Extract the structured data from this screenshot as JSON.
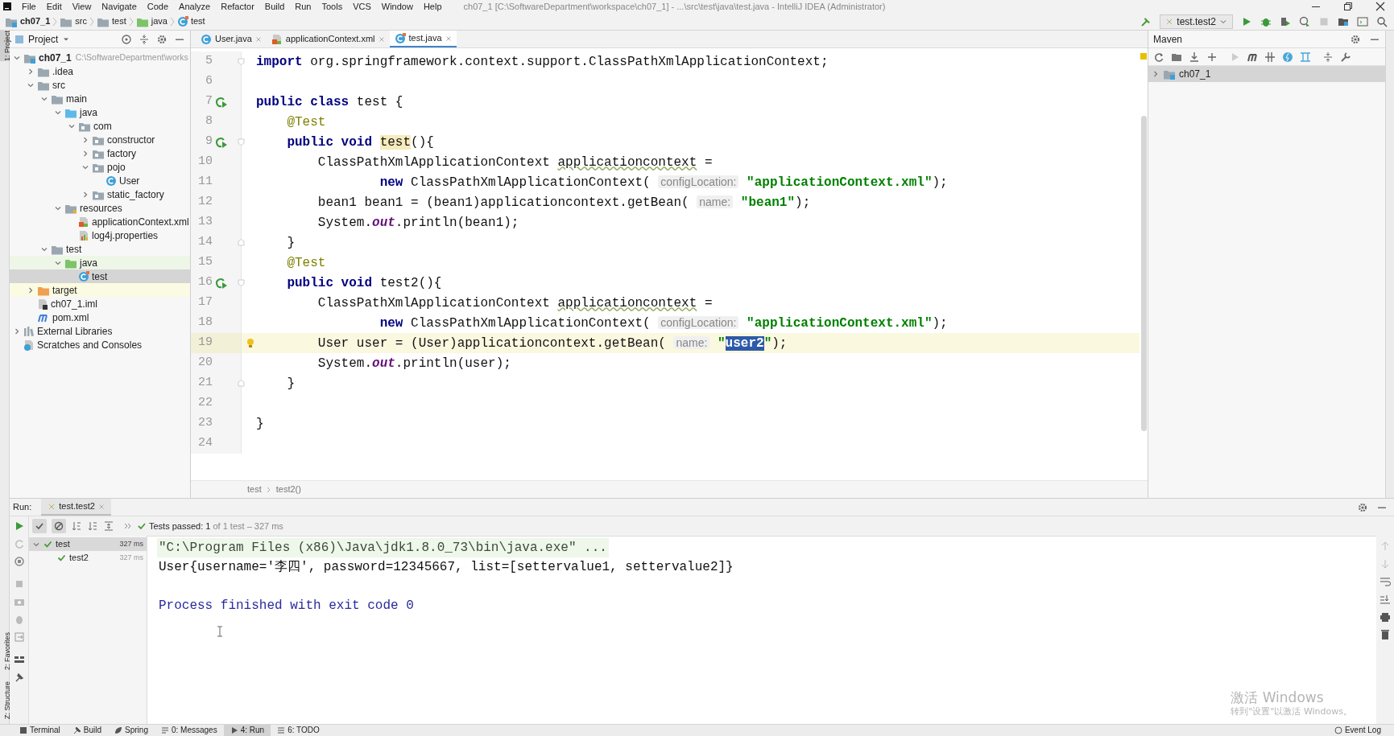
{
  "window": {
    "menu": [
      "File",
      "Edit",
      "View",
      "Navigate",
      "Code",
      "Analyze",
      "Refactor",
      "Build",
      "Run",
      "Tools",
      "VCS",
      "Window",
      "Help"
    ],
    "title": "ch07_1 [C:\\SoftwareDepartment\\workspace\\ch07_1] - ...\\src\\test\\java\\test.java - IntelliJ IDEA (Administrator)"
  },
  "side_tabs": [
    {
      "label": "1: Project",
      "selected": true
    },
    {
      "label": "2: Favorites",
      "selected": false
    },
    {
      "label": "Z: Structure",
      "selected": false
    }
  ],
  "navbar": {
    "breadcrumbs": [
      {
        "label": "ch07_1",
        "kind": "module"
      },
      {
        "label": "src",
        "kind": "folder"
      },
      {
        "label": "test",
        "kind": "folder"
      },
      {
        "label": "java",
        "kind": "test-source"
      },
      {
        "label": "test",
        "kind": "test-class"
      }
    ],
    "run_config": "test.test2"
  },
  "project_panel": {
    "title": "Project",
    "tree": [
      {
        "label": "ch07_1",
        "path": "C:\\SoftwareDepartment\\works",
        "kind": "module",
        "expanded": true,
        "selected": false,
        "children": [
          {
            "label": ".idea",
            "kind": "folder",
            "expanded": false,
            "selected": false
          },
          {
            "label": "src",
            "kind": "folder",
            "expanded": true,
            "selected": false,
            "children": [
              {
                "label": "main",
                "kind": "folder",
                "expanded": true,
                "selected": false,
                "children": [
                  {
                    "label": "java",
                    "kind": "source",
                    "expanded": true,
                    "selected": false,
                    "children": [
                      {
                        "label": "com",
                        "kind": "package",
                        "expanded": true,
                        "selected": false,
                        "children": [
                          {
                            "label": "constructor",
                            "kind": "package",
                            "expanded": false,
                            "selected": false
                          },
                          {
                            "label": "factory",
                            "kind": "package",
                            "expanded": false,
                            "selected": false
                          },
                          {
                            "label": "pojo",
                            "kind": "package",
                            "expanded": true,
                            "selected": false,
                            "children": [
                              {
                                "label": "User",
                                "kind": "class",
                                "selected": false
                              }
                            ]
                          },
                          {
                            "label": "static_factory",
                            "kind": "package",
                            "expanded": false,
                            "selected": false
                          }
                        ]
                      }
                    ]
                  },
                  {
                    "label": "resources",
                    "kind": "resources",
                    "expanded": true,
                    "selected": false,
                    "children": [
                      {
                        "label": "applicationContext.xml",
                        "kind": "xml",
                        "selected": false
                      },
                      {
                        "label": "log4j.properties",
                        "kind": "properties",
                        "selected": false
                      }
                    ]
                  }
                ]
              },
              {
                "label": "test",
                "kind": "folder",
                "expanded": true,
                "selected": false,
                "children": [
                  {
                    "label": "java",
                    "kind": "test-source",
                    "expanded": true,
                    "selected": false,
                    "children": [
                      {
                        "label": "test",
                        "kind": "test-class",
                        "selected": true
                      }
                    ]
                  }
                ]
              }
            ]
          },
          {
            "label": "target",
            "kind": "excluded",
            "expanded": false,
            "selected": false
          },
          {
            "label": "ch07_1.iml",
            "kind": "iml",
            "selected": false
          },
          {
            "label": "pom.xml",
            "kind": "maven",
            "selected": false
          }
        ]
      },
      {
        "label": "External Libraries",
        "kind": "libraries",
        "expanded": false,
        "selected": false
      },
      {
        "label": "Scratches and Consoles",
        "kind": "scratches",
        "selected": false
      }
    ]
  },
  "editor": {
    "tabs": [
      {
        "label": "User.java",
        "kind": "class",
        "selected": false
      },
      {
        "label": "applicationContext.xml",
        "kind": "xml",
        "selected": false
      },
      {
        "label": "test.java",
        "kind": "test-class",
        "selected": true
      }
    ],
    "lines": [
      {
        "number": "5",
        "current": false,
        "run_marker": false,
        "bulb": false,
        "fold_start": true,
        "fold_end": false,
        "tokens": [
          {
            "kind": "keyword",
            "text": "import "
          },
          {
            "kind": "plain",
            "text": "org.springframework.context.support.ClassPathXmlApplicationContext;"
          }
        ]
      },
      {
        "number": "6",
        "current": false,
        "run_marker": false,
        "bulb": false,
        "fold_start": false,
        "fold_end": false
      },
      {
        "number": "7",
        "current": false,
        "run_marker": true,
        "bulb": false,
        "fold_start": false,
        "fold_end": false,
        "tokens": [
          {
            "kind": "keyword",
            "text": "public class "
          },
          {
            "kind": "plain",
            "text": "test {"
          }
        ]
      },
      {
        "number": "8",
        "current": false,
        "run_marker": false,
        "bulb": false,
        "fold_start": false,
        "fold_end": false,
        "tokens": [
          {
            "kind": "annotation",
            "text": "    @Test"
          }
        ]
      },
      {
        "number": "9",
        "current": false,
        "run_marker": true,
        "bulb": false,
        "fold_start": true,
        "fold_end": false,
        "tokens": [
          {
            "kind": "keyword",
            "text": "    public void "
          },
          {
            "kind": "match",
            "text": "test"
          },
          {
            "kind": "plain",
            "text": "(){"
          }
        ]
      },
      {
        "number": "10",
        "current": false,
        "run_marker": false,
        "bulb": false,
        "fold_start": false,
        "fold_end": false,
        "tokens": [
          {
            "kind": "plain",
            "text": "        ClassPathXmlApplicationContext "
          },
          {
            "kind": "warning",
            "text": "applicationcontext"
          },
          {
            "kind": "plain",
            "text": " ="
          }
        ]
      },
      {
        "number": "11",
        "current": false,
        "run_marker": false,
        "bulb": false,
        "fold_start": false,
        "fold_end": false,
        "tokens": [
          {
            "kind": "keyword",
            "text": "                new "
          },
          {
            "kind": "plain",
            "text": "ClassPathXmlApplicationContext( "
          },
          {
            "kind": "hint",
            "text": "configLocation:"
          },
          {
            "kind": "string",
            "text": " \"applicationContext.xml\""
          },
          {
            "kind": "plain",
            "text": ");"
          }
        ]
      },
      {
        "number": "12",
        "current": false,
        "run_marker": false,
        "bulb": false,
        "fold_start": false,
        "fold_end": false,
        "tokens": [
          {
            "kind": "plain",
            "text": "        bean1 bean1 = (bean1)applicationcontext.getBean( "
          },
          {
            "kind": "hint",
            "text": "name:"
          },
          {
            "kind": "string",
            "text": " \"bean1\""
          },
          {
            "kind": "plain",
            "text": ");"
          }
        ]
      },
      {
        "number": "13",
        "current": false,
        "run_marker": false,
        "bulb": false,
        "fold_start": false,
        "fold_end": false,
        "tokens": [
          {
            "kind": "plain",
            "text": "        System."
          },
          {
            "kind": "static",
            "text": "out"
          },
          {
            "kind": "plain",
            "text": ".println(bean1);"
          }
        ]
      },
      {
        "number": "14",
        "current": false,
        "run_marker": false,
        "bulb": false,
        "fold_start": false,
        "fold_end": true,
        "tokens": [
          {
            "kind": "plain",
            "text": "    }"
          }
        ]
      },
      {
        "number": "15",
        "current": false,
        "run_marker": false,
        "bulb": false,
        "fold_start": false,
        "fold_end": false,
        "tokens": [
          {
            "kind": "annotation",
            "text": "    @Test"
          }
        ]
      },
      {
        "number": "16",
        "current": false,
        "run_marker": true,
        "bulb": false,
        "fold_start": true,
        "fold_end": false,
        "tokens": [
          {
            "kind": "keyword",
            "text": "    public void "
          },
          {
            "kind": "plain",
            "text": "test2(){"
          }
        ]
      },
      {
        "number": "17",
        "current": false,
        "run_marker": false,
        "bulb": false,
        "fold_start": false,
        "fold_end": false,
        "tokens": [
          {
            "kind": "plain",
            "text": "        ClassPathXmlApplicationContext "
          },
          {
            "kind": "warning",
            "text": "applicationcontext"
          },
          {
            "kind": "plain",
            "text": " ="
          }
        ]
      },
      {
        "number": "18",
        "current": false,
        "run_marker": false,
        "bulb": false,
        "fold_start": false,
        "fold_end": false,
        "tokens": [
          {
            "kind": "keyword",
            "text": "                new "
          },
          {
            "kind": "plain",
            "text": "ClassPathXmlApplicationContext( "
          },
          {
            "kind": "hint",
            "text": "configLocation:"
          },
          {
            "kind": "string",
            "text": " \"applicationContext.xml\""
          },
          {
            "kind": "plain",
            "text": ");"
          }
        ]
      },
      {
        "number": "19",
        "current": true,
        "run_marker": false,
        "bulb": true,
        "fold_start": false,
        "fold_end": false,
        "tokens": [
          {
            "kind": "plain",
            "text": "        User user = (User)applicationcontext.getBean( "
          },
          {
            "kind": "hint",
            "text": "name:"
          },
          {
            "kind": "string",
            "text": " \""
          },
          {
            "kind": "selection",
            "text": "user2"
          },
          {
            "kind": "string",
            "text": "\""
          },
          {
            "kind": "plain",
            "text": ");"
          }
        ]
      },
      {
        "number": "20",
        "current": false,
        "run_marker": false,
        "bulb": false,
        "fold_start": false,
        "fold_end": false,
        "tokens": [
          {
            "kind": "plain",
            "text": "        System."
          },
          {
            "kind": "static",
            "text": "out"
          },
          {
            "kind": "plain",
            "text": ".println(user);"
          }
        ]
      },
      {
        "number": "21",
        "current": false,
        "run_marker": false,
        "bulb": false,
        "fold_start": false,
        "fold_end": true,
        "tokens": [
          {
            "kind": "plain",
            "text": "    }"
          }
        ]
      },
      {
        "number": "22",
        "current": false,
        "run_marker": false,
        "bulb": false,
        "fold_start": false,
        "fold_end": false
      },
      {
        "number": "23",
        "current": false,
        "run_marker": false,
        "bulb": false,
        "fold_start": false,
        "fold_end": false,
        "tokens": [
          {
            "kind": "plain",
            "text": "}"
          }
        ]
      },
      {
        "number": "24",
        "current": false,
        "run_marker": false,
        "bulb": false,
        "fold_start": false,
        "fold_end": false
      }
    ],
    "breadcrumbs": [
      "test",
      "test2()"
    ]
  },
  "maven": {
    "title": "Maven",
    "tree": [
      {
        "label": "ch07_1",
        "expanded": false,
        "selected": true
      }
    ]
  },
  "run": {
    "label": "Run:",
    "tab": "test.test2",
    "summary": "Tests passed: 1",
    "detail": "of 1 test – 327 ms",
    "tests": [
      {
        "label": "test",
        "time": "327 ms",
        "expanded": true,
        "selected": true,
        "children": [
          {
            "label": "test2",
            "time": "327 ms",
            "selected": false
          }
        ]
      }
    ],
    "console": [
      {
        "kind": "command",
        "text": "\"C:\\Program Files (x86)\\Java\\jdk1.8.0_73\\bin\\java.exe\" ..."
      },
      {
        "kind": "output",
        "text": "User{username='李四', password=12345667, list=[settervalue1, settervalue2]}"
      },
      {
        "kind": "blank"
      },
      {
        "kind": "exit",
        "text": "Process finished with exit code 0"
      }
    ]
  },
  "bottom_bar": {
    "tabs": [
      {
        "label": "Terminal",
        "selected": false
      },
      {
        "label": "Build",
        "selected": false
      },
      {
        "label": "Spring",
        "selected": false
      },
      {
        "label": "0: Messages",
        "selected": false
      },
      {
        "label": "4: Run",
        "selected": true
      },
      {
        "label": "6: TODO",
        "selected": false
      }
    ],
    "event_log": "Event Log"
  },
  "activation": {
    "title": "激活 Windows",
    "subtitle": "转到\"设置\"以激活 Windows。"
  }
}
